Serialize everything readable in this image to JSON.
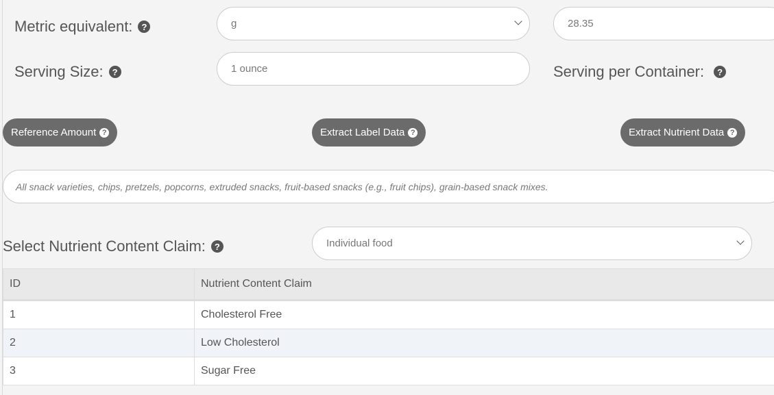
{
  "metric": {
    "label": "Metric equivalent:",
    "unit_value": "g",
    "amount_value": "28.35"
  },
  "serving": {
    "label": "Serving Size:",
    "value": "1 ounce",
    "per_container_label": "Serving per Container:"
  },
  "buttons": {
    "reference": "Reference Amount",
    "extract_label": "Extract Label Data",
    "extract_nutrient": "Extract Nutrient Data"
  },
  "description": "All snack varieties, chips, pretzels, popcorns, extruded snacks, fruit-based snacks (e.g., fruit chips), grain-based snack mixes.",
  "claim": {
    "label": "Select Nutrient Content Claim:",
    "selected": "Individual food"
  },
  "table": {
    "headers": [
      "ID",
      "Nutrient Content Claim"
    ],
    "rows": [
      [
        "1",
        "Cholesterol Free"
      ],
      [
        "2",
        "Low Cholesterol"
      ],
      [
        "3",
        "Sugar Free"
      ]
    ]
  },
  "icons": {
    "help": "question-circle-icon",
    "dropdown": "chevron-down-icon"
  }
}
